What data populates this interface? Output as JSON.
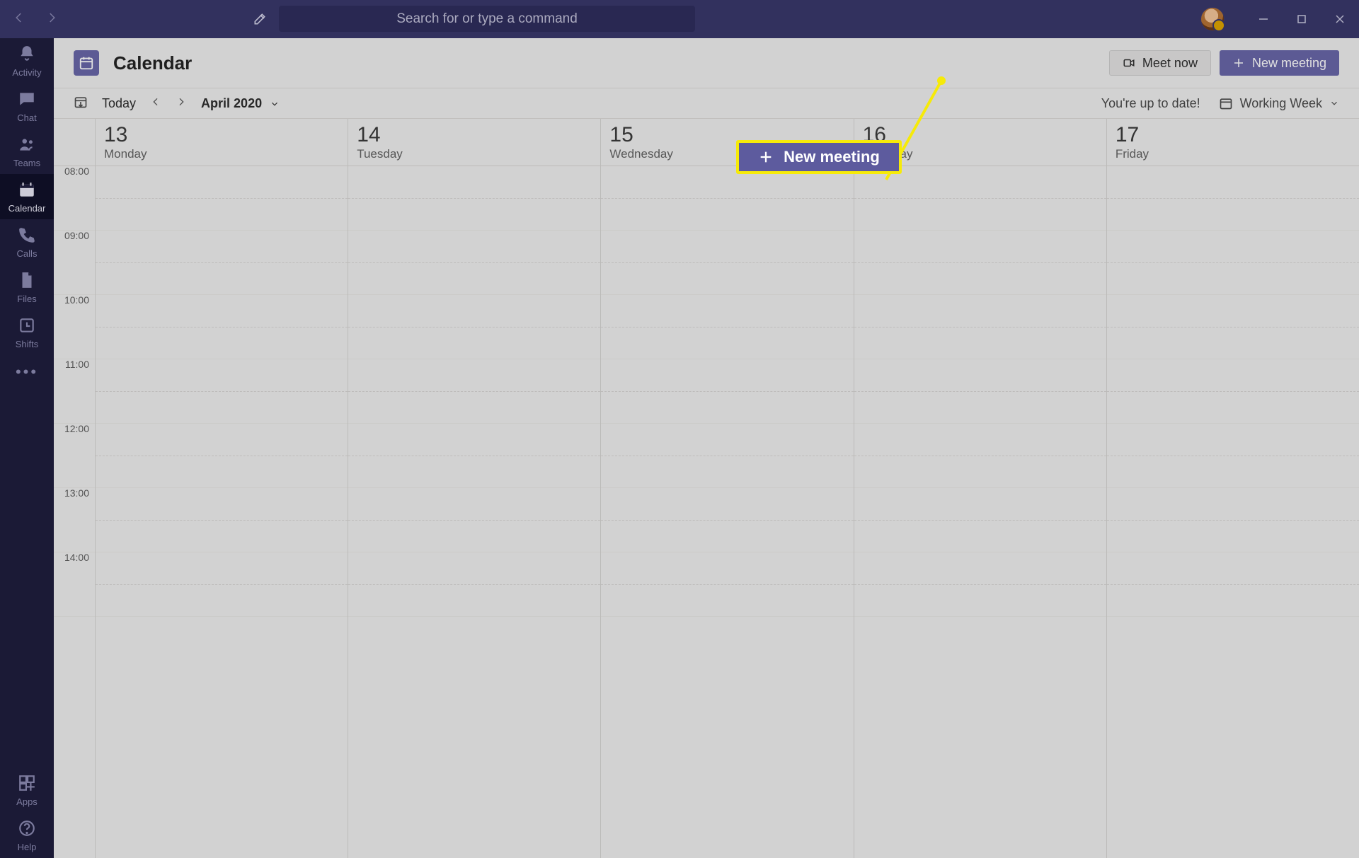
{
  "search_placeholder": "Search for or type a command",
  "rail": {
    "items": [
      {
        "label": "Activity"
      },
      {
        "label": "Chat"
      },
      {
        "label": "Teams"
      },
      {
        "label": "Calendar"
      },
      {
        "label": "Calls"
      },
      {
        "label": "Files"
      },
      {
        "label": "Shifts"
      }
    ],
    "bottom": [
      {
        "label": "Apps"
      },
      {
        "label": "Help"
      }
    ]
  },
  "header": {
    "title": "Calendar",
    "meet_now": "Meet now",
    "new_meeting": "New meeting"
  },
  "toolbar": {
    "today": "Today",
    "month": "April 2020",
    "status": "You're up to date!",
    "view": "Working Week"
  },
  "days": [
    {
      "num": "13",
      "name": "Monday"
    },
    {
      "num": "14",
      "name": "Tuesday"
    },
    {
      "num": "15",
      "name": "Wednesday"
    },
    {
      "num": "16",
      "name": "Thursday"
    },
    {
      "num": "17",
      "name": "Friday"
    }
  ],
  "hours": [
    "08:00",
    "09:00",
    "10:00",
    "11:00",
    "12:00",
    "13:00",
    "14:00"
  ],
  "callout": {
    "label": "New meeting"
  }
}
